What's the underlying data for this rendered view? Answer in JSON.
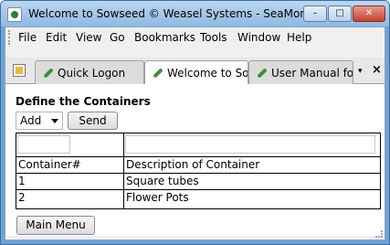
{
  "window": {
    "title": "Welcome to Sowseed © Weasel Systems - SeaMonkey",
    "buttons": {
      "minimize": "–",
      "maximize": "□",
      "close": "✕"
    }
  },
  "menubar": {
    "items": [
      {
        "label": "File"
      },
      {
        "label": "Edit"
      },
      {
        "label": "View"
      },
      {
        "label": "Go"
      },
      {
        "label": "Bookmarks"
      },
      {
        "label": "Tools"
      },
      {
        "label": "Window"
      },
      {
        "label": "Help"
      }
    ]
  },
  "tabs": [
    {
      "label": "Quick Logon",
      "icon": "leaf-icon",
      "active": false
    },
    {
      "label": "Welcome to So...",
      "icon": "leaf-icon",
      "active": true
    },
    {
      "label": "User Manual fo...",
      "icon": "leaf-icon",
      "active": false
    }
  ],
  "tabbar": {
    "list_glyph": "▾",
    "close_glyph": "×"
  },
  "page": {
    "heading": "Define the Containers",
    "action_select": {
      "selected": "Add"
    },
    "send_label": "Send",
    "table": {
      "columns": [
        "Container#",
        "Description of Container"
      ],
      "rows": [
        [
          "1",
          "Square tubes"
        ],
        [
          "2",
          "Flower Pots"
        ]
      ]
    },
    "main_menu_label": "Main Menu"
  }
}
